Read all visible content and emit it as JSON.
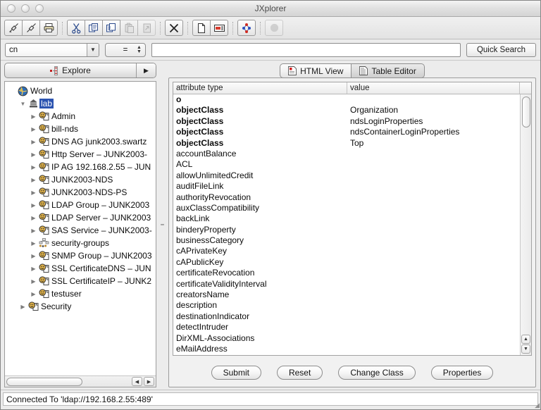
{
  "window": {
    "title": "JXplorer",
    "traffic_lights": [
      "close-button",
      "minimize-button",
      "zoom-button"
    ]
  },
  "toolbar": {
    "groups": [
      [
        {
          "name": "connect-button",
          "icon": "plug-connect-icon",
          "enabled": true
        },
        {
          "name": "disconnect-button",
          "icon": "plug-disconnect-icon",
          "enabled": true
        },
        {
          "name": "print-button",
          "icon": "printer-icon",
          "enabled": true
        }
      ],
      [
        {
          "name": "cut-button",
          "icon": "scissors-icon",
          "enabled": true
        },
        {
          "name": "copy-button",
          "icon": "copy-icon",
          "enabled": true
        },
        {
          "name": "copy-dn-button",
          "icon": "copy-dn-icon",
          "enabled": true
        },
        {
          "name": "paste-button",
          "icon": "paste-icon",
          "enabled": false
        },
        {
          "name": "paste-alias-button",
          "icon": "paste-alias-icon",
          "enabled": false
        }
      ],
      [
        {
          "name": "delete-button",
          "icon": "delete-x-icon",
          "enabled": true
        }
      ],
      [
        {
          "name": "new-entry-button",
          "icon": "new-document-icon",
          "enabled": true
        },
        {
          "name": "rename-button",
          "icon": "rename-icon",
          "enabled": true
        }
      ],
      [
        {
          "name": "refresh-tree-button",
          "icon": "refresh-molecule-icon",
          "enabled": true
        }
      ],
      [
        {
          "name": "stop-button",
          "icon": "stop-circle-icon",
          "enabled": false
        }
      ]
    ]
  },
  "search": {
    "attribute_value": "cn",
    "operator_value": "=",
    "field_value": "",
    "field_placeholder": "",
    "quick_search_label": "Quick Search"
  },
  "tree_panel": {
    "tab_label": "Explore",
    "tab_icon": "tree-icon",
    "next_button_icon": "right-arrow-icon",
    "nodes": [
      {
        "label": "World",
        "indent": 0,
        "toggle": "none",
        "icon": "globe-icon",
        "selected": false
      },
      {
        "label": "lab",
        "indent": 1,
        "toggle": "open",
        "icon": "org-icon",
        "selected": true
      },
      {
        "label": "Admin",
        "indent": 2,
        "toggle": "closed",
        "icon": "user-icon",
        "selected": false
      },
      {
        "label": "bill-nds",
        "indent": 2,
        "toggle": "closed",
        "icon": "user-icon",
        "selected": false
      },
      {
        "label": "DNS AG junk2003.swartz",
        "indent": 2,
        "toggle": "closed",
        "icon": "user-icon",
        "selected": false
      },
      {
        "label": "Http Server – JUNK2003-",
        "indent": 2,
        "toggle": "closed",
        "icon": "user-icon",
        "selected": false
      },
      {
        "label": "IP AG 192.168.2.55 – JUN",
        "indent": 2,
        "toggle": "closed",
        "icon": "user-icon",
        "selected": false
      },
      {
        "label": "JUNK2003-NDS",
        "indent": 2,
        "toggle": "closed",
        "icon": "user-icon",
        "selected": false
      },
      {
        "label": "JUNK2003-NDS-PS",
        "indent": 2,
        "toggle": "closed",
        "icon": "user-icon",
        "selected": false
      },
      {
        "label": "LDAP Group – JUNK2003",
        "indent": 2,
        "toggle": "closed",
        "icon": "user-icon",
        "selected": false
      },
      {
        "label": "LDAP Server – JUNK2003",
        "indent": 2,
        "toggle": "closed",
        "icon": "user-icon",
        "selected": false
      },
      {
        "label": "SAS Service – JUNK2003-",
        "indent": 2,
        "toggle": "closed",
        "icon": "user-icon",
        "selected": false
      },
      {
        "label": "security-groups",
        "indent": 2,
        "toggle": "closed",
        "icon": "group-icon",
        "selected": false
      },
      {
        "label": "SNMP Group – JUNK2003",
        "indent": 2,
        "toggle": "closed",
        "icon": "user-icon",
        "selected": false
      },
      {
        "label": "SSL CertificateDNS – JUN",
        "indent": 2,
        "toggle": "closed",
        "icon": "user-icon",
        "selected": false
      },
      {
        "label": "SSL CertificateIP – JUNK2",
        "indent": 2,
        "toggle": "closed",
        "icon": "user-icon",
        "selected": false
      },
      {
        "label": "testuser",
        "indent": 2,
        "toggle": "closed",
        "icon": "user-icon",
        "selected": false
      },
      {
        "label": "Security",
        "indent": 1,
        "toggle": "closed",
        "icon": "user-icon",
        "selected": false
      }
    ]
  },
  "editor_panel": {
    "tabs": [
      {
        "label": "HTML View",
        "icon": "html-page-icon",
        "selected": false
      },
      {
        "label": "Table Editor",
        "icon": "table-page-icon",
        "selected": true
      }
    ],
    "table": {
      "columns": [
        "attribute type",
        "value"
      ],
      "rows": [
        {
          "attribute": "o",
          "value": "",
          "required": true
        },
        {
          "attribute": "objectClass",
          "value": "Organization",
          "required": true
        },
        {
          "attribute": "objectClass",
          "value": "ndsLoginProperties",
          "required": true
        },
        {
          "attribute": "objectClass",
          "value": "ndsContainerLoginProperties",
          "required": true
        },
        {
          "attribute": "objectClass",
          "value": "Top",
          "required": true
        },
        {
          "attribute": "accountBalance",
          "value": "",
          "required": false
        },
        {
          "attribute": "ACL",
          "value": "",
          "required": false
        },
        {
          "attribute": "allowUnlimitedCredit",
          "value": "",
          "required": false
        },
        {
          "attribute": "auditFileLink",
          "value": "",
          "required": false
        },
        {
          "attribute": "authorityRevocation",
          "value": "",
          "required": false
        },
        {
          "attribute": "auxClassCompatibility",
          "value": "",
          "required": false
        },
        {
          "attribute": "backLink",
          "value": "",
          "required": false
        },
        {
          "attribute": "binderyProperty",
          "value": "",
          "required": false
        },
        {
          "attribute": "businessCategory",
          "value": "",
          "required": false
        },
        {
          "attribute": "cAPrivateKey",
          "value": "",
          "required": false
        },
        {
          "attribute": "cAPublicKey",
          "value": "",
          "required": false
        },
        {
          "attribute": "certificateRevocation",
          "value": "",
          "required": false
        },
        {
          "attribute": "certificateValidityInterval",
          "value": "",
          "required": false
        },
        {
          "attribute": "creatorsName",
          "value": "",
          "required": false
        },
        {
          "attribute": "description",
          "value": "",
          "required": false
        },
        {
          "attribute": "destinationIndicator",
          "value": "",
          "required": false
        },
        {
          "attribute": "detectIntruder",
          "value": "",
          "required": false
        },
        {
          "attribute": "DirXML-Associations",
          "value": "",
          "required": false
        },
        {
          "attribute": "eMailAddress",
          "value": "",
          "required": false
        }
      ]
    },
    "buttons": [
      {
        "label": "Submit",
        "name": "submit-button"
      },
      {
        "label": "Reset",
        "name": "reset-button"
      },
      {
        "label": "Change Class",
        "name": "change-class-button"
      },
      {
        "label": "Properties",
        "name": "properties-button"
      }
    ]
  },
  "status": {
    "text": "Connected To 'ldap://192.168.2.55:489'"
  },
  "colors": {
    "selection_blue": "#2b53b0",
    "window_chrome": "#ececec",
    "table_background": "#ffffff"
  }
}
